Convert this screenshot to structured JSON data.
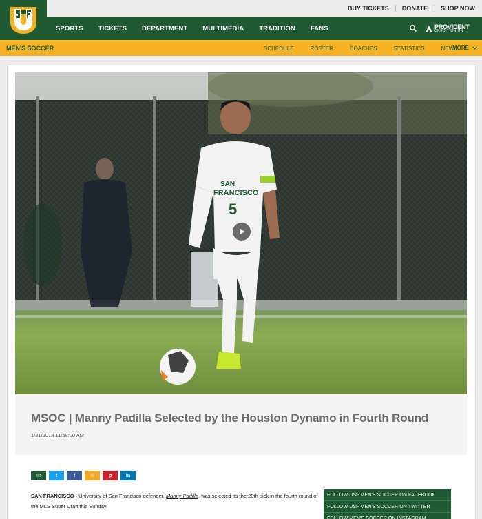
{
  "utility": {
    "links": [
      "BUY TICKETS",
      "DONATE",
      "SHOP NOW"
    ]
  },
  "logo": {
    "text": "USF"
  },
  "nav": {
    "items": [
      "SPORTS",
      "TICKETS",
      "DEPARTMENT",
      "MULTIMEDIA",
      "TRADITION",
      "FANS"
    ],
    "sponsor_line1": "PROVIDENT",
    "sponsor_line2": "CREDIT UNION"
  },
  "subnav": {
    "sport": "MEN'S SOCCER",
    "items": [
      "SCHEDULE",
      "ROSTER",
      "COACHES",
      "STATISTICS",
      "NEWS"
    ],
    "more": "MORE"
  },
  "hero": {
    "jersey_team": "SAN FRANCISCO",
    "jersey_number": "5"
  },
  "article": {
    "headline": "MSOC | Manny Padilla Selected by the Houston Dynamo in Fourth Round",
    "date": "1/21/2018 11:58:00 AM",
    "dateline": "SAN FRANCISCO -",
    "body_before": " University of San Francisco defender, ",
    "body_link": "Manny Padilla",
    "body_after": ", was selected as the 20th pick in the fourth round of the MLS Super Draft this Sunday."
  },
  "share": {
    "buttons": [
      {
        "name": "email",
        "color": "#1f5a32",
        "glyph": "✉"
      },
      {
        "name": "twitter",
        "color": "#1da1f2",
        "glyph": "t"
      },
      {
        "name": "facebook",
        "color": "#3b5998",
        "glyph": "f"
      },
      {
        "name": "mail",
        "color": "#f5a623",
        "glyph": "✉"
      },
      {
        "name": "pinterest",
        "color": "#c8232c",
        "glyph": "p"
      },
      {
        "name": "linkedin",
        "color": "#0077b5",
        "glyph": "in"
      }
    ]
  },
  "follow": {
    "links": [
      "FOLLOW USF MEN'S SOCCER ON FACEBOOK",
      "FOLLOW USF MEN'S SOCCER ON TWITTER",
      "FOLLOW MEN'S SOCCER ON INSTAGRAM"
    ]
  },
  "colors": {
    "green": "#1f5a32",
    "gold": "#f5b324"
  }
}
